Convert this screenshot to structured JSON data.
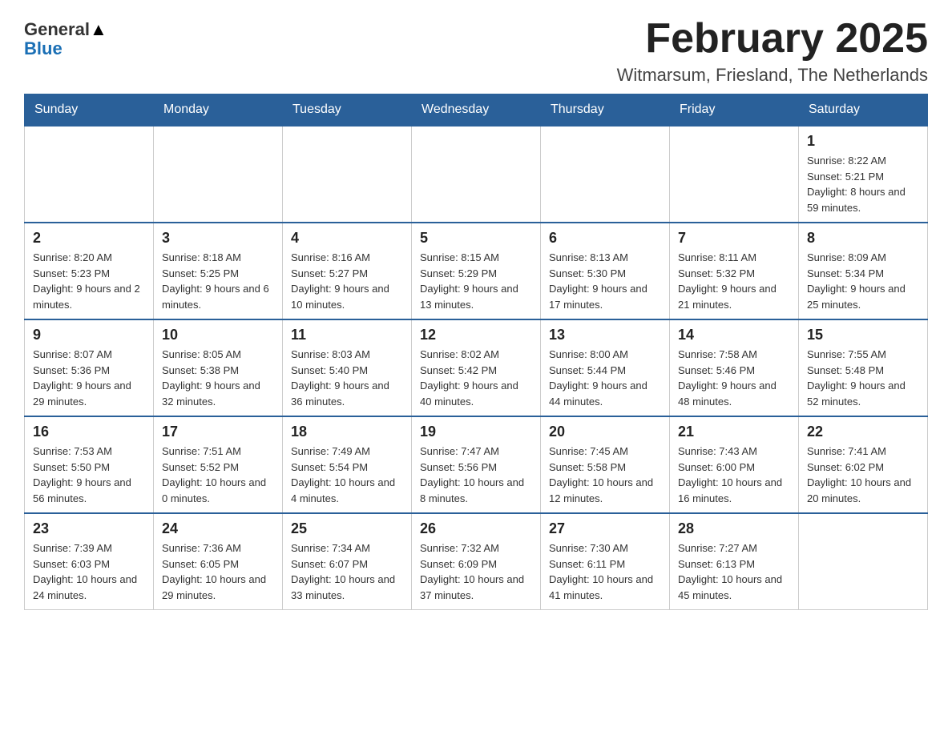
{
  "logo": {
    "general": "General",
    "blue": "Blue"
  },
  "header": {
    "month_year": "February 2025",
    "location": "Witmarsum, Friesland, The Netherlands"
  },
  "days_of_week": [
    "Sunday",
    "Monday",
    "Tuesday",
    "Wednesday",
    "Thursday",
    "Friday",
    "Saturday"
  ],
  "weeks": [
    [
      {
        "day": "",
        "sunrise": "",
        "sunset": "",
        "daylight": ""
      },
      {
        "day": "",
        "sunrise": "",
        "sunset": "",
        "daylight": ""
      },
      {
        "day": "",
        "sunrise": "",
        "sunset": "",
        "daylight": ""
      },
      {
        "day": "",
        "sunrise": "",
        "sunset": "",
        "daylight": ""
      },
      {
        "day": "",
        "sunrise": "",
        "sunset": "",
        "daylight": ""
      },
      {
        "day": "",
        "sunrise": "",
        "sunset": "",
        "daylight": ""
      },
      {
        "day": "1",
        "sunrise": "Sunrise: 8:22 AM",
        "sunset": "Sunset: 5:21 PM",
        "daylight": "Daylight: 8 hours and 59 minutes."
      }
    ],
    [
      {
        "day": "2",
        "sunrise": "Sunrise: 8:20 AM",
        "sunset": "Sunset: 5:23 PM",
        "daylight": "Daylight: 9 hours and 2 minutes."
      },
      {
        "day": "3",
        "sunrise": "Sunrise: 8:18 AM",
        "sunset": "Sunset: 5:25 PM",
        "daylight": "Daylight: 9 hours and 6 minutes."
      },
      {
        "day": "4",
        "sunrise": "Sunrise: 8:16 AM",
        "sunset": "Sunset: 5:27 PM",
        "daylight": "Daylight: 9 hours and 10 minutes."
      },
      {
        "day": "5",
        "sunrise": "Sunrise: 8:15 AM",
        "sunset": "Sunset: 5:29 PM",
        "daylight": "Daylight: 9 hours and 13 minutes."
      },
      {
        "day": "6",
        "sunrise": "Sunrise: 8:13 AM",
        "sunset": "Sunset: 5:30 PM",
        "daylight": "Daylight: 9 hours and 17 minutes."
      },
      {
        "day": "7",
        "sunrise": "Sunrise: 8:11 AM",
        "sunset": "Sunset: 5:32 PM",
        "daylight": "Daylight: 9 hours and 21 minutes."
      },
      {
        "day": "8",
        "sunrise": "Sunrise: 8:09 AM",
        "sunset": "Sunset: 5:34 PM",
        "daylight": "Daylight: 9 hours and 25 minutes."
      }
    ],
    [
      {
        "day": "9",
        "sunrise": "Sunrise: 8:07 AM",
        "sunset": "Sunset: 5:36 PM",
        "daylight": "Daylight: 9 hours and 29 minutes."
      },
      {
        "day": "10",
        "sunrise": "Sunrise: 8:05 AM",
        "sunset": "Sunset: 5:38 PM",
        "daylight": "Daylight: 9 hours and 32 minutes."
      },
      {
        "day": "11",
        "sunrise": "Sunrise: 8:03 AM",
        "sunset": "Sunset: 5:40 PM",
        "daylight": "Daylight: 9 hours and 36 minutes."
      },
      {
        "day": "12",
        "sunrise": "Sunrise: 8:02 AM",
        "sunset": "Sunset: 5:42 PM",
        "daylight": "Daylight: 9 hours and 40 minutes."
      },
      {
        "day": "13",
        "sunrise": "Sunrise: 8:00 AM",
        "sunset": "Sunset: 5:44 PM",
        "daylight": "Daylight: 9 hours and 44 minutes."
      },
      {
        "day": "14",
        "sunrise": "Sunrise: 7:58 AM",
        "sunset": "Sunset: 5:46 PM",
        "daylight": "Daylight: 9 hours and 48 minutes."
      },
      {
        "day": "15",
        "sunrise": "Sunrise: 7:55 AM",
        "sunset": "Sunset: 5:48 PM",
        "daylight": "Daylight: 9 hours and 52 minutes."
      }
    ],
    [
      {
        "day": "16",
        "sunrise": "Sunrise: 7:53 AM",
        "sunset": "Sunset: 5:50 PM",
        "daylight": "Daylight: 9 hours and 56 minutes."
      },
      {
        "day": "17",
        "sunrise": "Sunrise: 7:51 AM",
        "sunset": "Sunset: 5:52 PM",
        "daylight": "Daylight: 10 hours and 0 minutes."
      },
      {
        "day": "18",
        "sunrise": "Sunrise: 7:49 AM",
        "sunset": "Sunset: 5:54 PM",
        "daylight": "Daylight: 10 hours and 4 minutes."
      },
      {
        "day": "19",
        "sunrise": "Sunrise: 7:47 AM",
        "sunset": "Sunset: 5:56 PM",
        "daylight": "Daylight: 10 hours and 8 minutes."
      },
      {
        "day": "20",
        "sunrise": "Sunrise: 7:45 AM",
        "sunset": "Sunset: 5:58 PM",
        "daylight": "Daylight: 10 hours and 12 minutes."
      },
      {
        "day": "21",
        "sunrise": "Sunrise: 7:43 AM",
        "sunset": "Sunset: 6:00 PM",
        "daylight": "Daylight: 10 hours and 16 minutes."
      },
      {
        "day": "22",
        "sunrise": "Sunrise: 7:41 AM",
        "sunset": "Sunset: 6:02 PM",
        "daylight": "Daylight: 10 hours and 20 minutes."
      }
    ],
    [
      {
        "day": "23",
        "sunrise": "Sunrise: 7:39 AM",
        "sunset": "Sunset: 6:03 PM",
        "daylight": "Daylight: 10 hours and 24 minutes."
      },
      {
        "day": "24",
        "sunrise": "Sunrise: 7:36 AM",
        "sunset": "Sunset: 6:05 PM",
        "daylight": "Daylight: 10 hours and 29 minutes."
      },
      {
        "day": "25",
        "sunrise": "Sunrise: 7:34 AM",
        "sunset": "Sunset: 6:07 PM",
        "daylight": "Daylight: 10 hours and 33 minutes."
      },
      {
        "day": "26",
        "sunrise": "Sunrise: 7:32 AM",
        "sunset": "Sunset: 6:09 PM",
        "daylight": "Daylight: 10 hours and 37 minutes."
      },
      {
        "day": "27",
        "sunrise": "Sunrise: 7:30 AM",
        "sunset": "Sunset: 6:11 PM",
        "daylight": "Daylight: 10 hours and 41 minutes."
      },
      {
        "day": "28",
        "sunrise": "Sunrise: 7:27 AM",
        "sunset": "Sunset: 6:13 PM",
        "daylight": "Daylight: 10 hours and 45 minutes."
      },
      {
        "day": "",
        "sunrise": "",
        "sunset": "",
        "daylight": ""
      }
    ]
  ]
}
